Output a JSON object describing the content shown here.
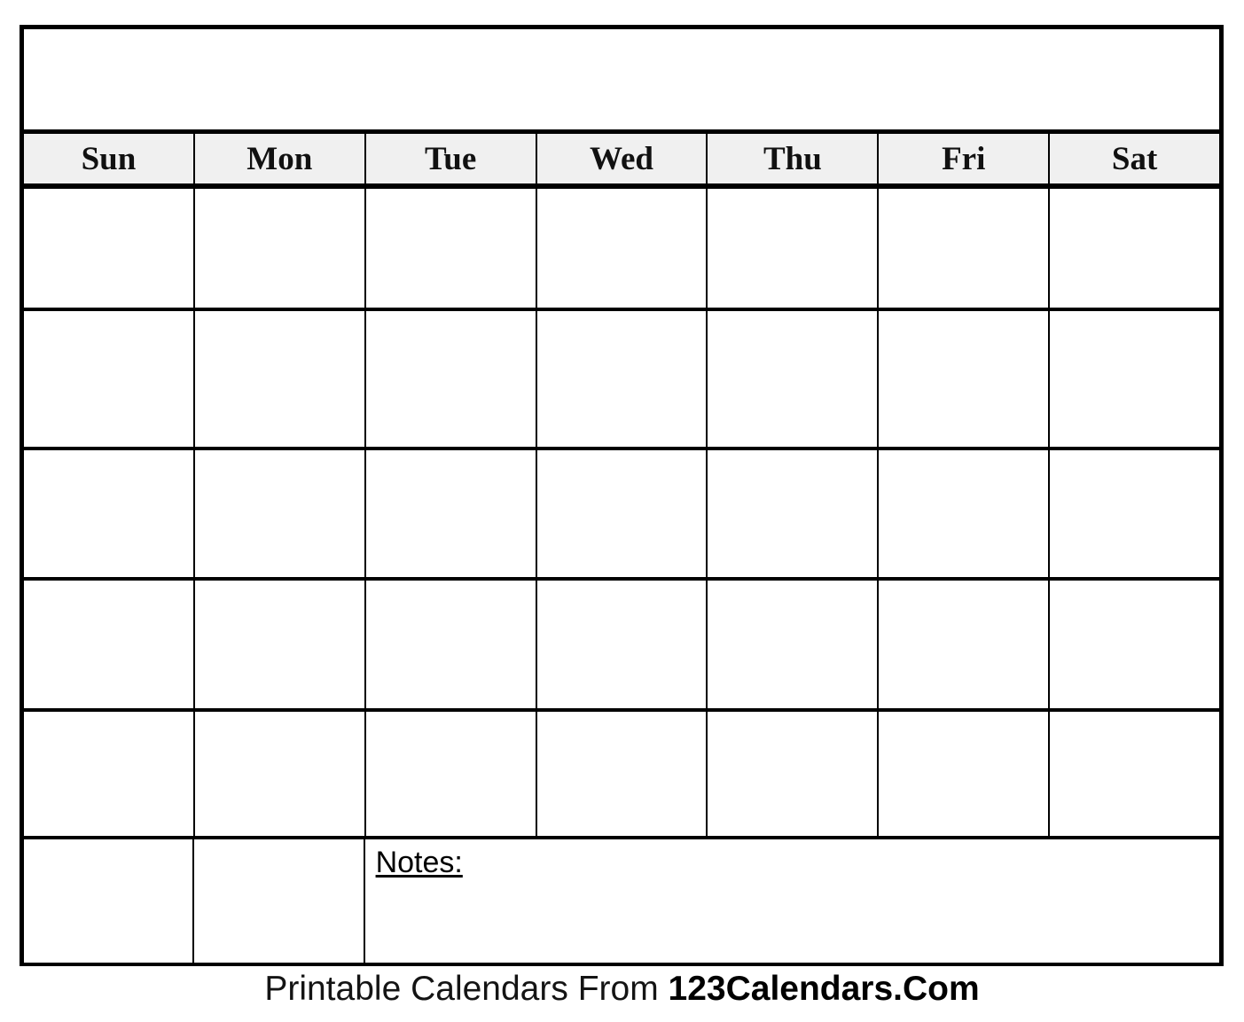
{
  "document": {
    "type": "blank-printable-monthly-calendar",
    "title_banner": {
      "month_title": "",
      "note": "blank month/year banner left empty for handwriting"
    }
  },
  "weekday_header": {
    "days": [
      {
        "label": "Sun"
      },
      {
        "label": "Mon"
      },
      {
        "label": "Tue"
      },
      {
        "label": "Wed"
      },
      {
        "label": "Thu"
      },
      {
        "label": "Fri"
      },
      {
        "label": "Sat"
      }
    ]
  },
  "weeks": [
    {
      "cells": [
        "",
        "",
        "",
        "",
        "",
        "",
        ""
      ]
    },
    {
      "cells": [
        "",
        "",
        "",
        "",
        "",
        "",
        ""
      ]
    },
    {
      "cells": [
        "",
        "",
        "",
        "",
        "",
        "",
        ""
      ]
    },
    {
      "cells": [
        "",
        "",
        "",
        "",
        "",
        "",
        ""
      ]
    },
    {
      "cells": [
        "",
        "",
        "",
        "",
        "",
        "",
        ""
      ]
    }
  ],
  "notes_row": {
    "empty_cells": [
      "",
      ""
    ],
    "notes_label": "Notes:",
    "notes_value": ""
  },
  "footer": {
    "prefix": "Printable Calendars From ",
    "brand": "123Calendars.Com"
  },
  "colors": {
    "page_background": "#ffffff",
    "border": "#000000",
    "weekday_header_background": "#f0f0f0",
    "text": "#000000"
  }
}
